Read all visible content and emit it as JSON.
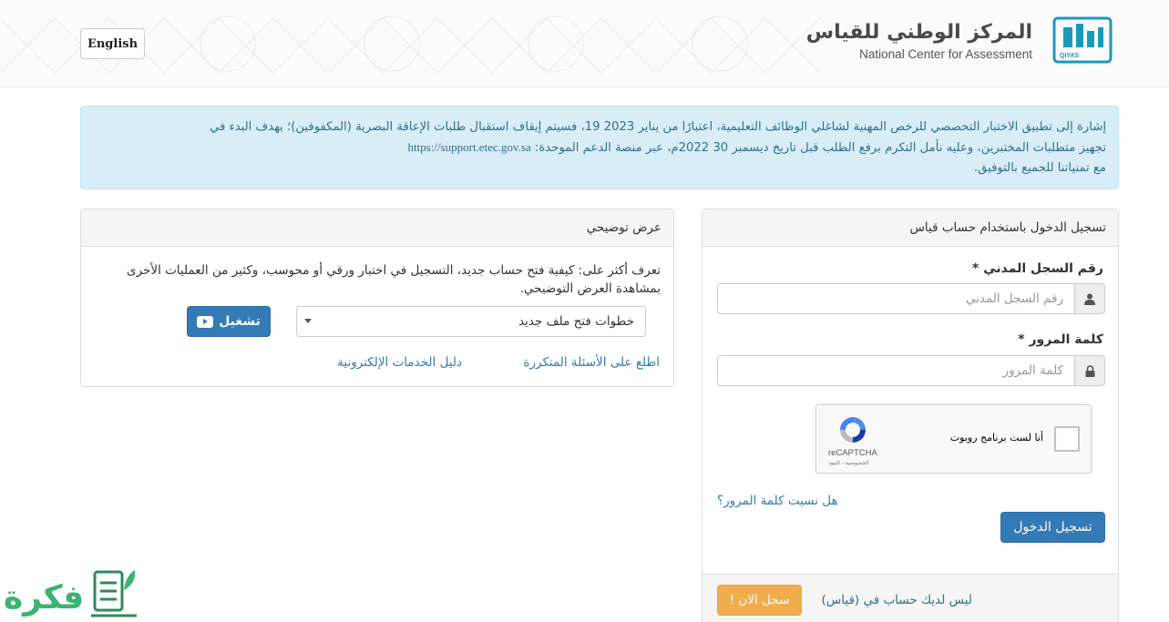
{
  "header": {
    "lang_button": "English",
    "brand_ar": "المركز الوطني للقياس",
    "brand_en": "National Center for Assessment",
    "logo_text": "QIYAS"
  },
  "notice": {
    "line1": "إشارة إلى تطبيق الاختبار التخصصي للرخص المهنية لشاغلي الوظائف التعليمية، اعتبارًا من يناير 2023 19، فسيتم إيقاف استقبال طلبات الإعاقة البصرية (المكفوفين)؛ بهدف البدء في",
    "line2": "تجهيز متطلبات المختبرين، وعليه نأمل التكرم برفع الطلب قبل تاريخ ديسمبر 30 2022م، عبر منصة الدعم الموحدة:",
    "url": "https://support.etec.gov.sa",
    "line3": "مع تمنياتنا للجميع بالتوفيق."
  },
  "demo": {
    "title": "عرض توضيحي",
    "description": "تعرف أكثر على: كيفية فتح حساب جديد، التسجيل في اختبار ورقي أو محوسب، وكثير من العمليات الأخرى بمشاهدة العرض التوضيحي.",
    "select_value": "خطوات فتح ملف جديد",
    "play_label": "تشغيل",
    "faq_link": "اطلع على الأسئلة المتكررة",
    "guide_link": "دليل الخدمات الإلكترونية"
  },
  "login": {
    "title": "تسجيل الدخول باستخدام حساب قياس",
    "id_label": "رقم السجل المدني *",
    "id_placeholder": "رقم السجل المدني",
    "password_label": "كلمة المرور *",
    "password_placeholder": "كلمة المرور",
    "captcha_text": "أنا لست برنامج روبوت",
    "captcha_brand": "reCAPTCHA",
    "captcha_terms": "الخصوصية - البنود",
    "forgot_link": "هل نسيت كلمة المرور؟",
    "submit_label": "تسجيل الدخول",
    "no_account_text": "ليس لديك حساب في (قياس)",
    "register_label": "سجل الان !"
  },
  "watermark": {
    "text": "فكرة"
  },
  "colors": {
    "primary": "#337ab7",
    "info_bg": "#d9edf7",
    "info_text": "#31708f",
    "warning": "#f0ad4e",
    "logo_teal": "#1a9ab8",
    "watermark_green": "#3cb371"
  }
}
